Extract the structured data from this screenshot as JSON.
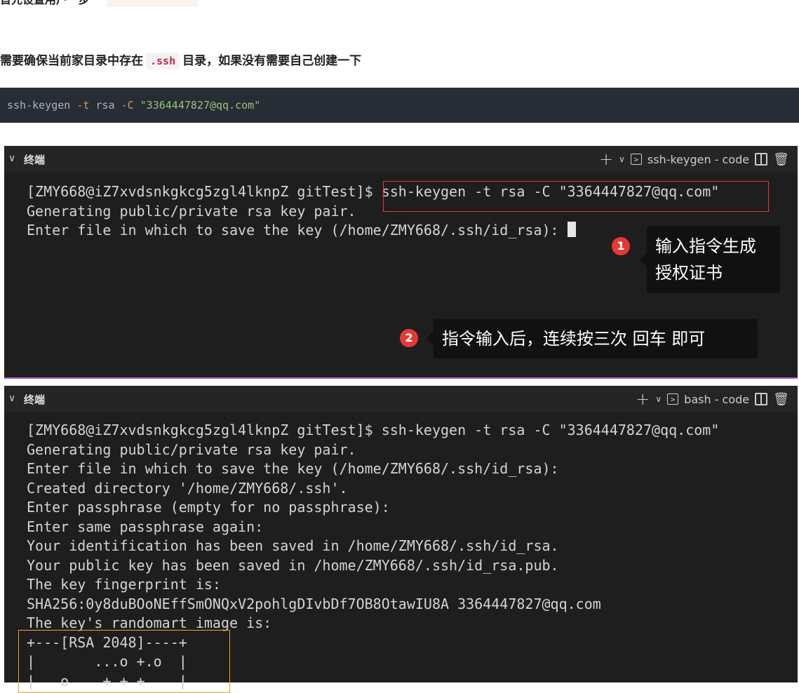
{
  "article": {
    "top_text": "首先设置用户一步",
    "note_prefix": "需要确保当前家目录中存在",
    "note_code": ".ssh",
    "note_suffix": "目录，如果没有需要自己创建一下",
    "command": {
      "cmd": "ssh-keygen ",
      "flag_t": "-t",
      "arg_t": " rsa ",
      "flag_c": "-C",
      "email": " \"3364447827@qq.com\""
    }
  },
  "terminal1": {
    "header_title": "终端",
    "shell_label": "ssh-keygen - code",
    "lines": [
      "[ZMY668@iZ7xvdsnkgkcg5zgl4lknpZ gitTest]$ ssh-keygen -t rsa -C \"3364447827@qq.com\"",
      "Generating public/private rsa key pair.",
      "Enter file in which to save the key (/home/ZMY668/.ssh/id_rsa): "
    ],
    "tip1": {
      "badge": "1",
      "text": "输入指令生成\n授权证书"
    },
    "tip2": {
      "badge": "2",
      "text": "指令输入后，连续按三次 回车 即可"
    }
  },
  "terminal2": {
    "header_title": "终端",
    "shell_label": "bash - code",
    "lines": [
      "[ZMY668@iZ7xvdsnkgkcg5zgl4lknpZ gitTest]$ ssh-keygen -t rsa -C \"3364447827@qq.com\"",
      "Generating public/private rsa key pair.",
      "Enter file in which to save the key (/home/ZMY668/.ssh/id_rsa):",
      "Created directory '/home/ZMY668/.ssh'.",
      "Enter passphrase (empty for no passphrase):",
      "Enter same passphrase again:",
      "Your identification has been saved in /home/ZMY668/.ssh/id_rsa.",
      "Your public key has been saved in /home/ZMY668/.ssh/id_rsa.pub.",
      "The key fingerprint is:",
      "SHA256:0y8duBOoNEffSmONQxV2pohlgDIvbDf7OB8OtawIU8A 3364447827@qq.com",
      "The key's randomart image is:",
      "+---[RSA 2048]----+",
      "|       ...o +.o  |",
      "|   o    + + +    |"
    ]
  },
  "colors": {
    "terminal_bg": "#1e1e1e",
    "highlight_red": "#e53935",
    "highlight_orange": "#f0a030",
    "code_bg": "#282c34"
  },
  "icons": [
    "chevron-down-icon",
    "plus-icon",
    "terminal-shell-icon",
    "split-icon",
    "trash-icon"
  ]
}
